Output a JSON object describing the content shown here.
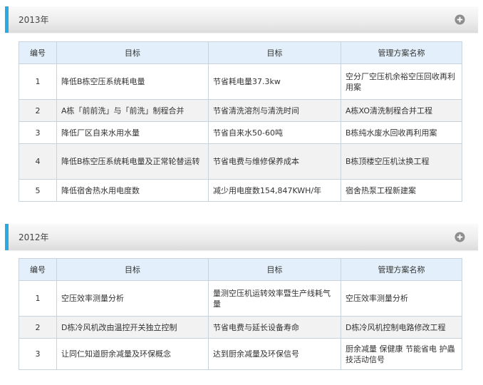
{
  "colors": {
    "accent": "#29abe2",
    "table_header_bg": "#e3f0fb",
    "table_border": "#c8d3dc",
    "alt_row_bg": "#f2f2f2"
  },
  "columns": [
    "编号",
    "目标",
    "目标",
    "管理方案名称"
  ],
  "sections": [
    {
      "year": "2013年",
      "icon": "plus-circle-icon",
      "rows": [
        [
          "1",
          "降低B栋空压系统耗电量",
          "节省耗电量37.3kw",
          "空分厂空压机余裕空压回收再利用案"
        ],
        [
          "2",
          "A栋「前前洗」与「前洗」制程合并",
          "节省清洗溶剂与清洗时间",
          "A栋XO清洗制程合并工程"
        ],
        [
          "3",
          "降低厂区自来水用水量",
          "节省自来水50-60吨",
          "B栋纯水废水回收再利用案"
        ],
        [
          "4",
          "降低B栋空压系统耗电量及正常轮替运转",
          "节省电费与维修保养成本",
          "B栋顶楼空压机汰换工程"
        ],
        [
          "5",
          "降低宿舍热水用电度数",
          "减少用电度数154,847KWH/年",
          "宿舍热泵工程新建案"
        ]
      ]
    },
    {
      "year": "2012年",
      "icon": "plus-circle-icon",
      "rows": [
        [
          "1",
          "空压效率测量分析",
          "量测空压机运转效率暨生产线耗气量",
          "空压效率测量分析"
        ],
        [
          "2",
          "D栋冷风机改由温控开关独立控制",
          "节省电费与延长设备寿命",
          "D栋冷风机控制电路修改工程"
        ],
        [
          "3",
          "让同仁知道厨余减量及环保概念",
          "达到厨余减量及环保信号",
          "厨余减量 保健康 节能省电 护蟲技活动信号"
        ]
      ]
    }
  ]
}
